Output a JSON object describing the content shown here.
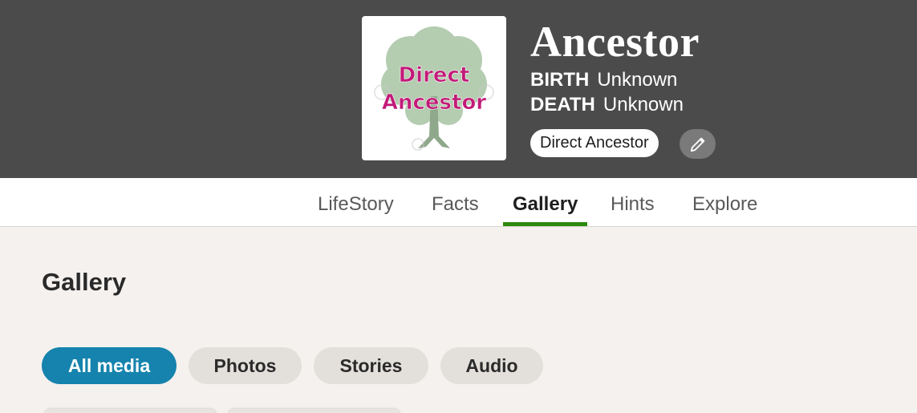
{
  "profile": {
    "name": "Ancestor",
    "photo_text_line1": "Direct",
    "photo_text_line2": "Ancestor",
    "birth_label": "BIRTH",
    "birth_value": "Unknown",
    "death_label": "DEATH",
    "death_value": "Unknown",
    "badge": "Direct Ancestor",
    "edit_icon": "pencil-icon"
  },
  "tabs": [
    {
      "label": "LifeStory",
      "active": false
    },
    {
      "label": "Facts",
      "active": false
    },
    {
      "label": "Gallery",
      "active": true
    },
    {
      "label": "Hints",
      "active": false
    },
    {
      "label": "Explore",
      "active": false
    }
  ],
  "gallery": {
    "title": "Gallery",
    "filters": [
      {
        "label": "All media",
        "active": true
      },
      {
        "label": "Photos",
        "active": false
      },
      {
        "label": "Stories",
        "active": false
      },
      {
        "label": "Audio",
        "active": false
      }
    ]
  },
  "colors": {
    "header_bg": "#4b4b4b",
    "page_bg": "#f5f1ee",
    "active_tab_underline": "#2d8a0e",
    "active_chip": "#1583ad",
    "photo_text": "#c21a78"
  }
}
